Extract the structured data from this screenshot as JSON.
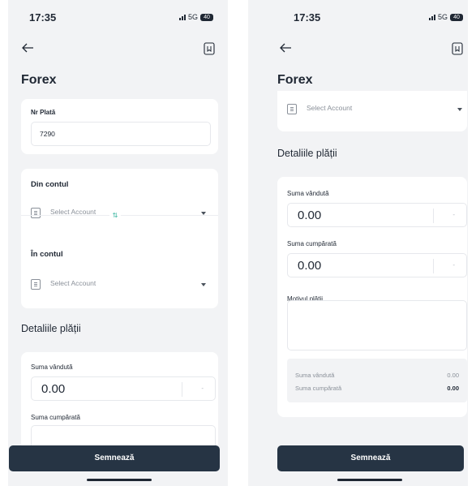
{
  "status": {
    "time": "17:35",
    "network": "5G",
    "battery": "40"
  },
  "left_screen": {
    "title": "Forex",
    "payment_number": {
      "label": "Nr Plată",
      "value": "7290"
    },
    "from_account": {
      "label": "Din contul",
      "placeholder": "Select Account"
    },
    "to_account": {
      "label": "În contul",
      "placeholder": "Select Account"
    },
    "details_heading": "Detaliile plății",
    "sold_amount": {
      "label": "Suma vândută",
      "value": "0.00"
    },
    "bought_amount": {
      "label": "Suma cumpărată"
    },
    "submit_label": "Semnează"
  },
  "right_screen": {
    "title": "Forex",
    "account_select": {
      "placeholder": "Select Account"
    },
    "details_heading": "Detaliile plății",
    "sold_amount": {
      "label": "Suma vândută",
      "value": "0.00"
    },
    "bought_amount": {
      "label": "Suma cumpărată",
      "value": "0.00"
    },
    "reason": {
      "label": "Motivul plății"
    },
    "summary": {
      "sold_label": "Suma vândută",
      "sold_value": "0.00",
      "bought_label": "Suma cumpărată",
      "bought_value": "0.00"
    },
    "submit_label": "Semnează"
  },
  "colors": {
    "primary_button": "#263444",
    "background": "#f2f3f5",
    "card": "#ffffff",
    "accent": "#3bb6a2"
  },
  "icons": [
    "back-arrow-icon",
    "bookmark-icon",
    "account-icon",
    "chevron-down-icon",
    "swap-icon"
  ]
}
